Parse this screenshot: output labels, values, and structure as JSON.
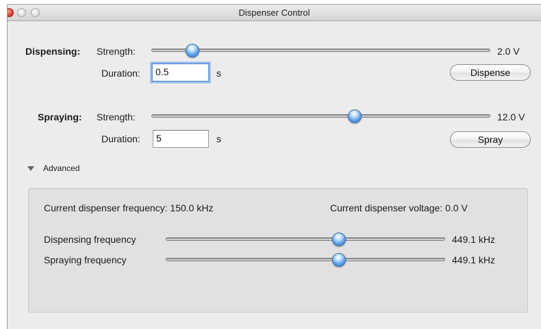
{
  "window": {
    "title": "Dispenser Control"
  },
  "dispensing": {
    "section_label": "Dispensing:",
    "strength_label": "Strength:",
    "strength_value": "2.0 V",
    "strength_fraction": 0.12,
    "duration_label": "Duration:",
    "duration_value": "0.5",
    "duration_unit": "s",
    "action_button": "Dispense"
  },
  "spraying": {
    "section_label": "Spraying:",
    "strength_label": "Strength:",
    "strength_value": "12.0 V",
    "strength_fraction": 0.6,
    "duration_label": "Duration:",
    "duration_value": "5",
    "duration_unit": "s",
    "action_button": "Spray"
  },
  "advanced": {
    "toggle_label": "Advanced",
    "frequency_readout": "Current dispenser frequency: 150.0 kHz",
    "voltage_readout": "Current dispenser voltage: 0.0 V",
    "dispensing_frequency_label": "Dispensing frequency",
    "dispensing_frequency_value": "449.1 kHz",
    "dispensing_frequency_fraction": 0.62,
    "spraying_frequency_label": "Spraying frequency",
    "spraying_frequency_value": "449.1 kHz",
    "spraying_frequency_fraction": 0.62
  }
}
